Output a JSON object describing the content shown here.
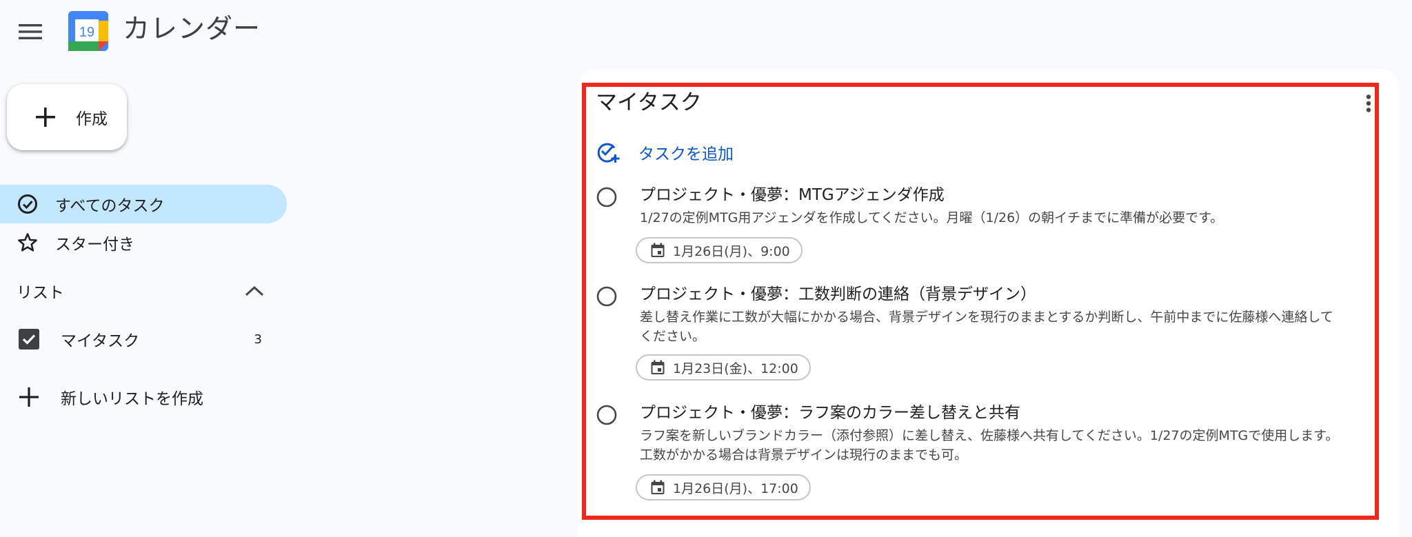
{
  "app": {
    "title": "カレンダー",
    "logo_day": "19"
  },
  "icons": {
    "menu": "hamburger-menu-icon",
    "plus": "plus-icon",
    "all_tasks": "check-circle-icon",
    "starred": "star-icon",
    "collapse": "chevron-up-icon",
    "checkbox": "checked-checkbox-icon",
    "add_task": "add-task-icon",
    "radio": "radio-circle-icon",
    "calendar": "calendar-icon",
    "more": "more-vert-icon"
  },
  "sidebar": {
    "create_label": "作成",
    "nav": [
      {
        "label": "すべてのタスク",
        "active": true
      },
      {
        "label": "スター付き",
        "active": false
      }
    ],
    "lists_heading": "リスト",
    "lists": [
      {
        "label": "マイタスク",
        "count": "3",
        "checked": true
      }
    ],
    "new_list_label": "新しいリストを作成"
  },
  "panel": {
    "title": "マイタスク",
    "add_task_label": "タスクを追加",
    "tasks": [
      {
        "title": "プロジェクト・優夢：MTGアジェンダ作成",
        "description": "1/27の定例MTG用アジェンダを作成してください。月曜（1/26）の朝イチまでに準備が必要です。",
        "due": "1月26日(月)、9:00"
      },
      {
        "title": "プロジェクト・優夢：工数判断の連絡（背景デザイン）",
        "description": "差し替え作業に工数が大幅にかかる場合、背景デザインを現行のままとするか判断し、午前中までに佐藤様へ連絡してください。",
        "due": "1月23日(金)、12:00"
      },
      {
        "title": "プロジェクト・優夢：ラフ案のカラー差し替えと共有",
        "description": "ラフ案を新しいブランドカラー（添付参照）に差し替え、佐藤様へ共有してください。1/27の定例MTGで使用します。工数がかかる場合は背景デザインは現行のままでも可。",
        "due": "1月26日(月)、17:00"
      }
    ]
  },
  "colors": {
    "background": "#f8fafd",
    "panel": "#ffffff",
    "active_nav": "#c2e7ff",
    "link_blue": "#0b57d0",
    "highlight_border": "#f0281a",
    "text_primary": "#1f1f1f",
    "text_secondary": "#444746"
  }
}
